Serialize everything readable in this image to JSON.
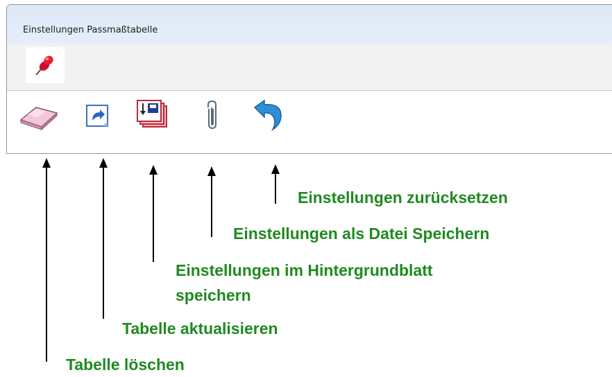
{
  "window": {
    "title": "Einstellungen Passmaßtabelle"
  },
  "pinbar": {
    "icon": "pushpin-icon"
  },
  "toolbar": {
    "items": [
      {
        "icon": "eraser-icon"
      },
      {
        "icon": "refresh-icon"
      },
      {
        "icon": "save-to-sheet-icon"
      },
      {
        "icon": "paperclip-icon"
      },
      {
        "icon": "undo-icon"
      }
    ]
  },
  "callouts": {
    "reset": "Einstellungen zurücksetzen",
    "save_file": "Einstellungen als Datei Speichern",
    "save_sheet_line1": "Einstellungen im Hintergrundblatt",
    "save_sheet_line2": "speichern",
    "update": "Tabelle aktualisieren",
    "delete": "Tabelle löschen"
  },
  "colors": {
    "callout_text": "#1f8a1f",
    "arrow": "#000000"
  }
}
